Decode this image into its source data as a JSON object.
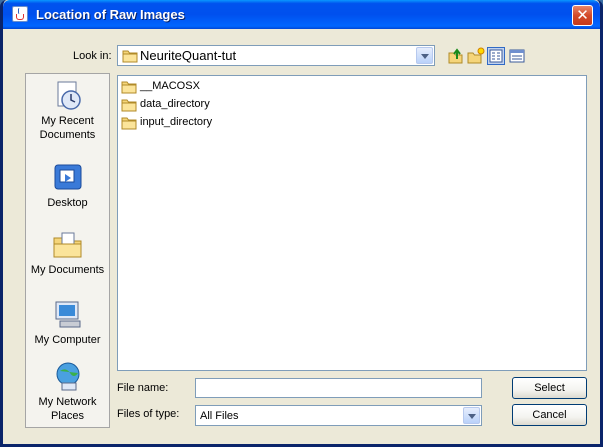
{
  "window": {
    "title": "Location of Raw Images",
    "close_symbol": "✕"
  },
  "lookin": {
    "label": "Look in:",
    "value": "NeuriteQuant-tut"
  },
  "toolbar": {
    "buttons": [
      {
        "name": "up-one-level-icon"
      },
      {
        "name": "create-new-folder-icon"
      },
      {
        "name": "list-view-icon",
        "active": true
      },
      {
        "name": "details-view-icon"
      }
    ]
  },
  "places": [
    {
      "label": "My Recent Documents",
      "icon": "recent-documents-icon"
    },
    {
      "label": "Desktop",
      "icon": "desktop-icon"
    },
    {
      "label": "My Documents",
      "icon": "my-documents-icon"
    },
    {
      "label": "My Computer",
      "icon": "my-computer-icon"
    },
    {
      "label": "My Network Places",
      "icon": "network-places-icon"
    }
  ],
  "files": [
    {
      "name": "__MACOSX",
      "type": "folder"
    },
    {
      "name": "data_directory",
      "type": "folder"
    },
    {
      "name": "input_directory",
      "type": "folder"
    }
  ],
  "filename": {
    "label": "File name:",
    "value": ""
  },
  "filetype": {
    "label": "Files of type:",
    "value": "All Files"
  },
  "buttons": {
    "select": "Select",
    "cancel": "Cancel"
  },
  "colors": {
    "title_bar": "#0054e3",
    "window_bg": "#ece9d8",
    "border": "#7f9db9"
  }
}
